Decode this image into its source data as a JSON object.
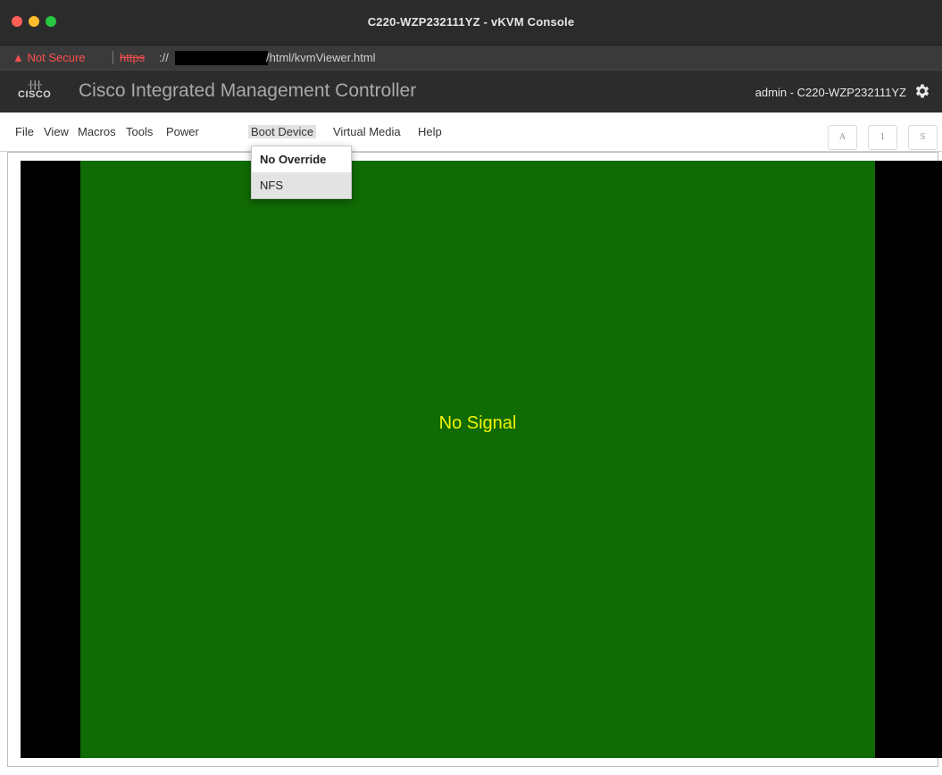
{
  "window": {
    "title": "C220-WZP232111YZ - vKVM Console"
  },
  "address": {
    "security_label": "▲ Not Secure",
    "scheme": "https",
    "scheme_sep": "://",
    "path_suffix": "/html/kvmViewer.html"
  },
  "header": {
    "logo_bars": "·|·|·|·",
    "logo_word": "CISCO",
    "app_title": "Cisco Integrated Management Controller",
    "user_host": "admin - C220-WZP232111YZ"
  },
  "menu": {
    "items": [
      "File",
      "View",
      "Macros",
      "Tools",
      "Power",
      "Boot Device",
      "Virtual Media",
      "Help"
    ],
    "active": "Boot Device"
  },
  "keyboard_indicators": [
    "A",
    "1",
    "S"
  ],
  "dropdown": {
    "items": [
      "No Override",
      "NFS"
    ]
  },
  "console": {
    "message": "No Signal",
    "message_color": "#f2f200",
    "bg_color": "#106b04"
  }
}
